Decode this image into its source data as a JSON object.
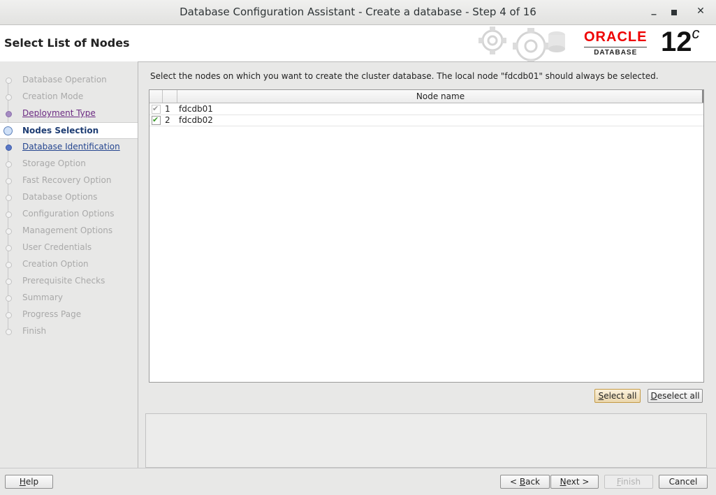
{
  "window": {
    "title": "Database Configuration Assistant - Create a database - Step 4 of 16",
    "min_icon": "minimize-icon",
    "max_icon": "maximize-icon",
    "close_icon": "close-icon"
  },
  "header": {
    "page_title": "Select List of Nodes",
    "logo_word": "ORACLE",
    "logo_sub": "DATABASE",
    "version": "12",
    "version_sup": "c"
  },
  "steps": [
    {
      "label": "Database Operation",
      "state": "disabled"
    },
    {
      "label": "Creation Mode",
      "state": "disabled"
    },
    {
      "label": "Deployment Type",
      "state": "visited"
    },
    {
      "label": "Nodes Selection",
      "state": "current"
    },
    {
      "label": "Database Identification",
      "state": "link"
    },
    {
      "label": "Storage Option",
      "state": "disabled"
    },
    {
      "label": "Fast Recovery Option",
      "state": "disabled"
    },
    {
      "label": "Database Options",
      "state": "disabled"
    },
    {
      "label": "Configuration Options",
      "state": "disabled"
    },
    {
      "label": "Management Options",
      "state": "disabled"
    },
    {
      "label": "User Credentials",
      "state": "disabled"
    },
    {
      "label": "Creation Option",
      "state": "disabled"
    },
    {
      "label": "Prerequisite Checks",
      "state": "disabled"
    },
    {
      "label": "Summary",
      "state": "disabled"
    },
    {
      "label": "Progress Page",
      "state": "disabled"
    },
    {
      "label": "Finish",
      "state": "disabled"
    }
  ],
  "main": {
    "instruction": "Select the nodes on which you want to create the cluster database. The local node \"fdcdb01\" should always be selected.",
    "column_header": "Node name",
    "nodes": [
      {
        "num": "1",
        "name": "fdcdb01",
        "checked": true,
        "disabled": true
      },
      {
        "num": "2",
        "name": "fdcdb02",
        "checked": true,
        "disabled": false
      }
    ],
    "select_all": {
      "pre": "",
      "mnemonic": "S",
      "post": "elect all"
    },
    "deselect_all": {
      "pre": "",
      "mnemonic": "D",
      "post": "eselect all"
    }
  },
  "footer": {
    "help": {
      "pre": "",
      "mnemonic": "H",
      "post": "elp"
    },
    "back": {
      "pre": "< ",
      "mnemonic": "B",
      "post": "ack"
    },
    "next": {
      "pre": "",
      "mnemonic": "N",
      "post": "ext >"
    },
    "finish": {
      "pre": "",
      "mnemonic": "F",
      "post": "inish"
    },
    "cancel": "Cancel"
  },
  "colors": {
    "oracle_red": "#e00000",
    "current_step": "#1e3d73",
    "visited_step": "#6b2a82",
    "link_step": "#24458f",
    "check_green": "#3a9a2a"
  }
}
